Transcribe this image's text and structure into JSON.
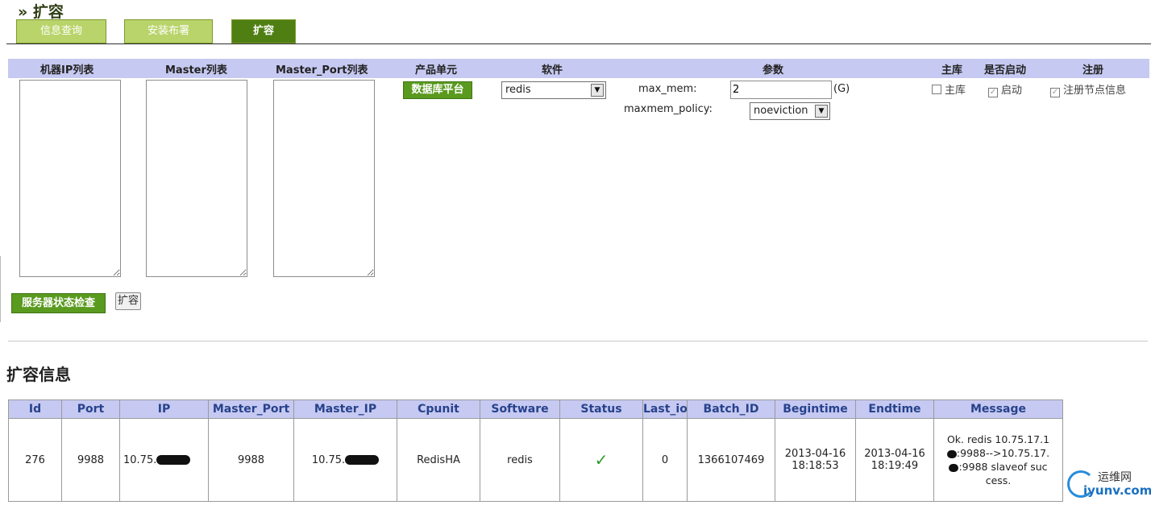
{
  "page": {
    "title": "» 扩容"
  },
  "tabs": [
    {
      "label": "信息查询",
      "active": false
    },
    {
      "label": "安装布署",
      "active": false
    },
    {
      "label": "扩容",
      "active": true
    }
  ],
  "form": {
    "headers": {
      "ip_list": "机器IP列表",
      "master_list": "Master列表",
      "master_port_list": "Master_Port列表",
      "product_unit": "产品单元",
      "software": "软件",
      "params": "参数",
      "master_db": "主库",
      "enabled": "是否启动",
      "register": "注册"
    },
    "product_unit_button": "数据库平台",
    "software_select": {
      "value": "redis"
    },
    "params": {
      "max_mem_label": "max_mem:",
      "max_mem_value": "2",
      "max_mem_unit": "(G)",
      "policy_label": "maxmem_policy:",
      "policy_value": "noeviction"
    },
    "checkboxes": {
      "master_db": {
        "label": "主库",
        "checked": false
      },
      "enabled": {
        "label": "启动",
        "checked": true
      },
      "register": {
        "label": "注册节点信息",
        "checked": true
      }
    },
    "check_button": "服务器状态检查",
    "expand_button": "扩容"
  },
  "info": {
    "title": "扩容信息",
    "columns": [
      "Id",
      "Port",
      "IP",
      "Master_Port",
      "Master_IP",
      "Cpunit",
      "Software",
      "Status",
      "Last_io",
      "Batch_ID",
      "Begintime",
      "Endtime",
      "Message"
    ],
    "row": {
      "id": "276",
      "port": "9988",
      "ip_prefix": "10.75.",
      "master_port": "9988",
      "master_ip_prefix": "10.75.",
      "cpunit": "RedisHA",
      "software": "redis",
      "status_icon": "check-icon",
      "last_io": "0",
      "batch_id": "1366107469",
      "begintime_date": "2013-04-16",
      "begintime_time": "18:18:53",
      "endtime_date": "2013-04-16",
      "endtime_time": "18:19:49",
      "message_line1": "Ok. redis 10.75.17.1",
      "message_line2": ":9988-->10.75.17.",
      "message_line3": ":9988 slaveof suc",
      "message_line4": "cess."
    }
  },
  "watermark": {
    "cn": "运维网",
    "en": "iyunv.com"
  },
  "colors": {
    "tab_active": "#4f7f13",
    "tab_inactive": "#b9d46a",
    "header_bg": "#c6c9f1",
    "header_text": "#27428c",
    "status_ok": "#2f9a2f"
  }
}
